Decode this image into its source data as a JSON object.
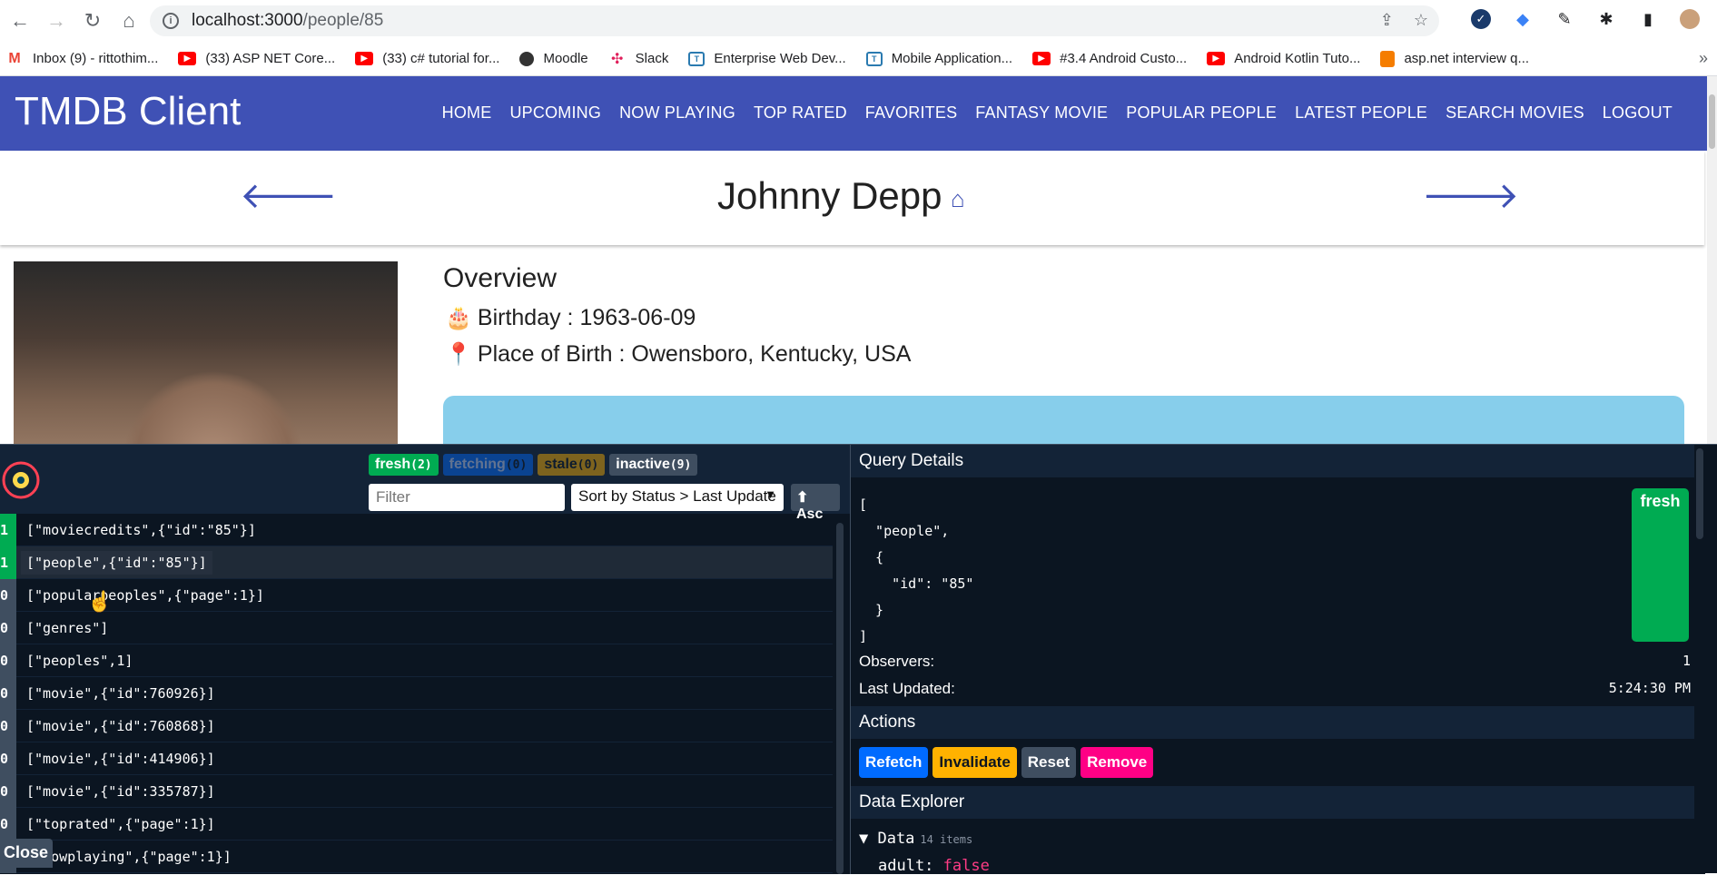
{
  "browser": {
    "url_host": "localhost:3000",
    "url_path": "/people/85",
    "bookmarks": [
      {
        "label": "Inbox (9) - rittothim...",
        "icon": "gmail"
      },
      {
        "label": "(33) ASP NET Core...",
        "icon": "youtube"
      },
      {
        "label": "(33) c# tutorial for...",
        "icon": "youtube"
      },
      {
        "label": "Moodle",
        "icon": "moodle"
      },
      {
        "label": "Slack",
        "icon": "slack"
      },
      {
        "label": "Enterprise Web Dev...",
        "icon": "teams"
      },
      {
        "label": "Mobile Application...",
        "icon": "teams"
      },
      {
        "label": "#3.4 Android Custo...",
        "icon": "youtube"
      },
      {
        "label": "Android Kotlin Tuto...",
        "icon": "youtube"
      },
      {
        "label": "asp.net interview q...",
        "icon": "blogger"
      }
    ]
  },
  "app": {
    "brand": "TMDB Client",
    "nav": [
      "HOME",
      "UPCOMING",
      "NOW PLAYING",
      "TOP RATED",
      "FAVORITES",
      "FANTASY MOVIE",
      "POPULAR PEOPLE",
      "LATEST PEOPLE",
      "SEARCH MOVIES",
      "LOGOUT"
    ],
    "colors": {
      "primary": "#3f51b5",
      "bio_bg": "#87ceeb"
    }
  },
  "person": {
    "name": "Johnny Depp",
    "overview_title": "Overview",
    "birthday_label": "Birthday : 1963-06-09",
    "birthplace_label": "Place of Birth : Owensboro, Kentucky, USA"
  },
  "devtools": {
    "badges": {
      "fresh": "fresh",
      "fresh_count": "(2)",
      "fetching": "fetching",
      "fetching_count": "(0)",
      "stale": "stale",
      "stale_count": "(0)",
      "inactive": "inactive",
      "inactive_count": "(9)"
    },
    "filter_placeholder": "Filter",
    "sort_label": "Sort by Status > Last Update",
    "asc_label": "⬆ Asc",
    "close_label": "Close",
    "queries": [
      {
        "observers": "1",
        "key": "[\"moviecredits\",{\"id\":\"85\"}]",
        "fresh": true
      },
      {
        "observers": "1",
        "key": "[\"people\",{\"id\":\"85\"}]",
        "fresh": true,
        "active": true
      },
      {
        "observers": "0",
        "key": "[\"popularpeoples\",{\"page\":1}]"
      },
      {
        "observers": "0",
        "key": "[\"genres\"]"
      },
      {
        "observers": "0",
        "key": "[\"peoples\",1]"
      },
      {
        "observers": "0",
        "key": "[\"movie\",{\"id\":760926}]"
      },
      {
        "observers": "0",
        "key": "[\"movie\",{\"id\":760868}]"
      },
      {
        "observers": "0",
        "key": "[\"movie\",{\"id\":414906}]"
      },
      {
        "observers": "0",
        "key": "[\"movie\",{\"id\":335787}]"
      },
      {
        "observers": "0",
        "key": "[\"toprated\",{\"page\":1}]"
      },
      {
        "observers": "0",
        "key": "[\"nowplaying\",{\"page\":1}]"
      }
    ],
    "details": {
      "title": "Query Details",
      "query_json": "[\n  \"people\",\n  {\n    \"id\": \"85\"\n  }\n]",
      "status": "fresh",
      "observers_label": "Observers:",
      "observers_value": "1",
      "updated_label": "Last Updated:",
      "updated_value": "5:24:30 PM",
      "actions_title": "Actions",
      "actions": {
        "refetch": "Refetch",
        "invalidate": "Invalidate",
        "reset": "Reset",
        "remove": "Remove"
      },
      "explorer_title": "Data Explorer",
      "explorer_root": "▼ Data",
      "explorer_count": "14 items",
      "explorer_key": "adult:",
      "explorer_value": "false"
    }
  }
}
